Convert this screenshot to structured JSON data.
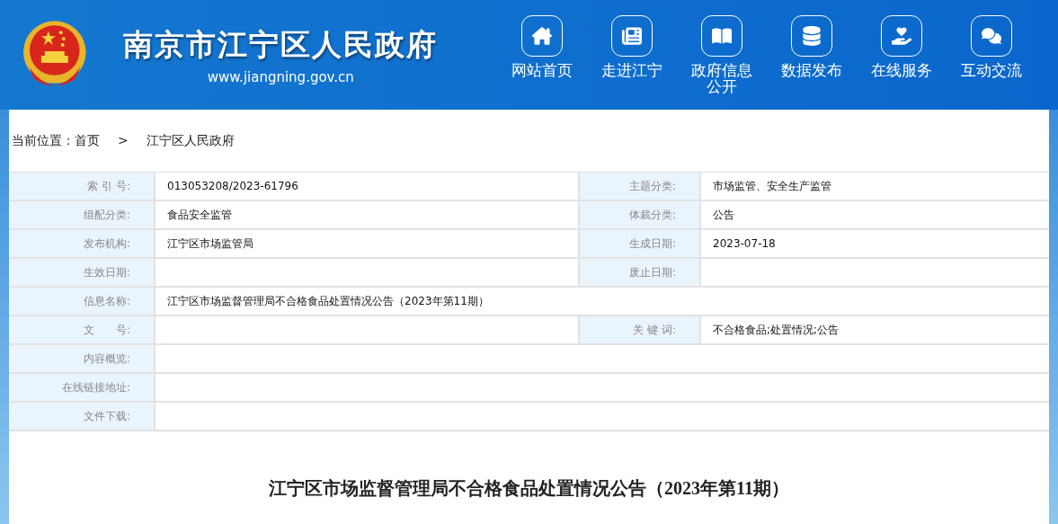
{
  "header": {
    "title": "南京市江宁区人民政府",
    "url": "www.jiangning.gov.cn",
    "nav": [
      {
        "label": "网站首页",
        "kind": "home"
      },
      {
        "label": "走进江宁",
        "kind": "news"
      },
      {
        "label": "政府信息公开",
        "kind": "book"
      },
      {
        "label": "数据发布",
        "kind": "data"
      },
      {
        "label": "在线服务",
        "kind": "service"
      },
      {
        "label": "互动交流",
        "kind": "chat"
      }
    ]
  },
  "breadcrumb": {
    "prefix": "当前位置：",
    "items": [
      "首页",
      "江宁区人民政府"
    ],
    "separator": ">"
  },
  "meta": [
    {
      "cells": [
        {
          "label": "索 引 号:",
          "value": "013053208/2023-61796"
        },
        {
          "label": "主题分类:",
          "value": "市场监管、安全生产监管"
        }
      ]
    },
    {
      "cells": [
        {
          "label": "组配分类:",
          "value": "食品安全监管"
        },
        {
          "label": "体裁分类:",
          "value": "公告"
        }
      ]
    },
    {
      "cells": [
        {
          "label": "发布机构:",
          "value": "江宁区市场监管局"
        },
        {
          "label": "生成日期:",
          "value": "2023-07-18"
        }
      ]
    },
    {
      "cells": [
        {
          "label": "生效日期:"
        },
        {
          "label": "废止日期:"
        }
      ]
    },
    {
      "cells": [
        {
          "label": "信息名称:",
          "value": "江宁区市场监督管理局不合格食品处置情况公告（2023年第11期）"
        }
      ]
    },
    {
      "cells": [
        {
          "label": "文　　号:"
        },
        {
          "label": "关 键 词:",
          "value": "不合格食品;处置情况;公告"
        }
      ]
    },
    {
      "cells": [
        {
          "label": "内容概览:"
        }
      ]
    },
    {
      "cells": [
        {
          "label": "在线链接地址:"
        }
      ]
    },
    {
      "cells": [
        {
          "label": "文件下载:"
        }
      ]
    }
  ],
  "article": {
    "title": "江宁区市场监督管理局不合格食品处置情况公告（2023年第11期）"
  }
}
